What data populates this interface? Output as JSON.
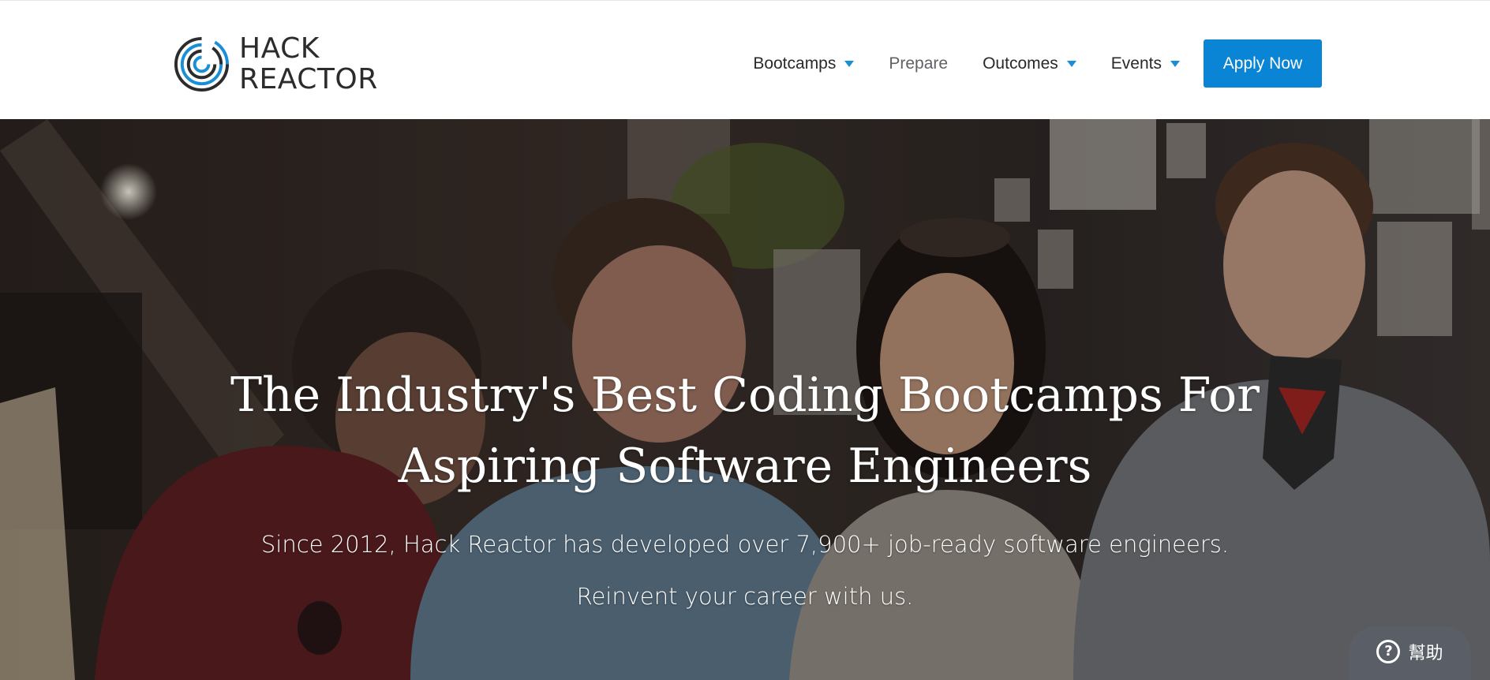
{
  "brand": {
    "line1": "HACK",
    "line2": "REACTOR",
    "logo_icon": "concentric-c-logo-icon",
    "logo_color_dark": "#2c2c2c",
    "logo_color_accent": "#1b8fd6"
  },
  "nav": {
    "items": [
      {
        "label": "Bootcamps",
        "has_dropdown": true
      },
      {
        "label": "Prepare",
        "has_dropdown": false
      },
      {
        "label": "Outcomes",
        "has_dropdown": true
      },
      {
        "label": "Events",
        "has_dropdown": true
      }
    ],
    "cta_label": "Apply Now",
    "cta_color": "#0a84d4",
    "caret_color": "#1b8fd6"
  },
  "hero": {
    "title_line1": "The Industry's Best Coding Bootcamps For",
    "title_line2": "Aspiring Software Engineers",
    "subtitle_line1": "Since 2012, Hack Reactor has developed over 7,900+ job-ready software engineers.",
    "subtitle_line2": "Reinvent your career with us."
  },
  "help_widget": {
    "label": "幫助",
    "icon": "question-circle-icon",
    "icon_glyph": "?"
  }
}
